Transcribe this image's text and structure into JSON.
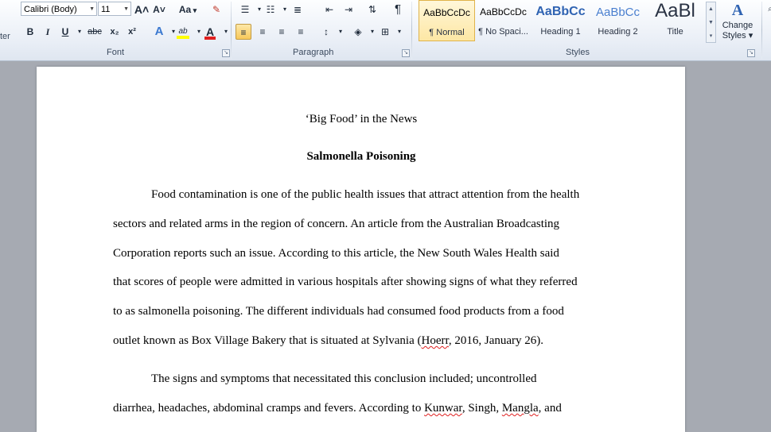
{
  "ribbon": {
    "left_fragment": "ter",
    "font": {
      "name": "Calibri (Body)",
      "size": "11",
      "group_label": "Font",
      "grow_icon": "A˄",
      "shrink_icon": "A˅",
      "case_label": "Aa",
      "bold": "B",
      "italic": "I",
      "underline": "U",
      "strike": "abc",
      "subscript": "x₂",
      "superscript": "x²",
      "highlight_label": "ab",
      "font_color_label": "A"
    },
    "paragraph": {
      "group_label": "Paragraph",
      "pilcrow": "¶"
    },
    "styles": {
      "group_label": "Styles",
      "tiles": [
        {
          "sample": "AaBbCcDc",
          "name": "¶ Normal"
        },
        {
          "sample": "AaBbCcDc",
          "name": "¶ No Spaci..."
        },
        {
          "sample": "AaBbCc",
          "name": "Heading 1"
        },
        {
          "sample": "AaBbCc",
          "name": "Heading 2"
        },
        {
          "sample": "AaBl",
          "name": "Title"
        }
      ],
      "change_styles_line1": "Change",
      "change_styles_line2": "Styles ▾"
    },
    "colors": {
      "highlight": "#ffff00",
      "font_color": "#e02020",
      "heading": "#2f63b2"
    }
  },
  "document": {
    "title": "‘Big Food’ in the News",
    "subtitle": "Salmonella Poisoning",
    "p1_lines": [
      "Food contamination is one of the public health issues that attract attention from the health",
      "sectors and related arms in the region of concern. An article from the Australian Broadcasting",
      "Corporation reports such an issue. According to this article, the New South Wales Health said",
      "that scores of people were admitted in various hospitals after showing signs of what they referred",
      "to as salmonella poisoning. The different individuals had consumed food products from a food"
    ],
    "p1_last_pre": "outlet known as Box Village Bakery that is situated at Sylvania (",
    "p1_last_err": "Hoerr",
    "p1_last_post": ", 2016, January 26).",
    "p2_line1": "The signs and symptoms that necessitated this conclusion included; uncontrolled",
    "p2_line2_pre": "diarrhea, headaches, abdominal cramps and fevers. According to ",
    "p2_err1": "Kunwar",
    "p2_mid": ", Singh, ",
    "p2_err2": "Mangla",
    "p2_end": ", and"
  }
}
